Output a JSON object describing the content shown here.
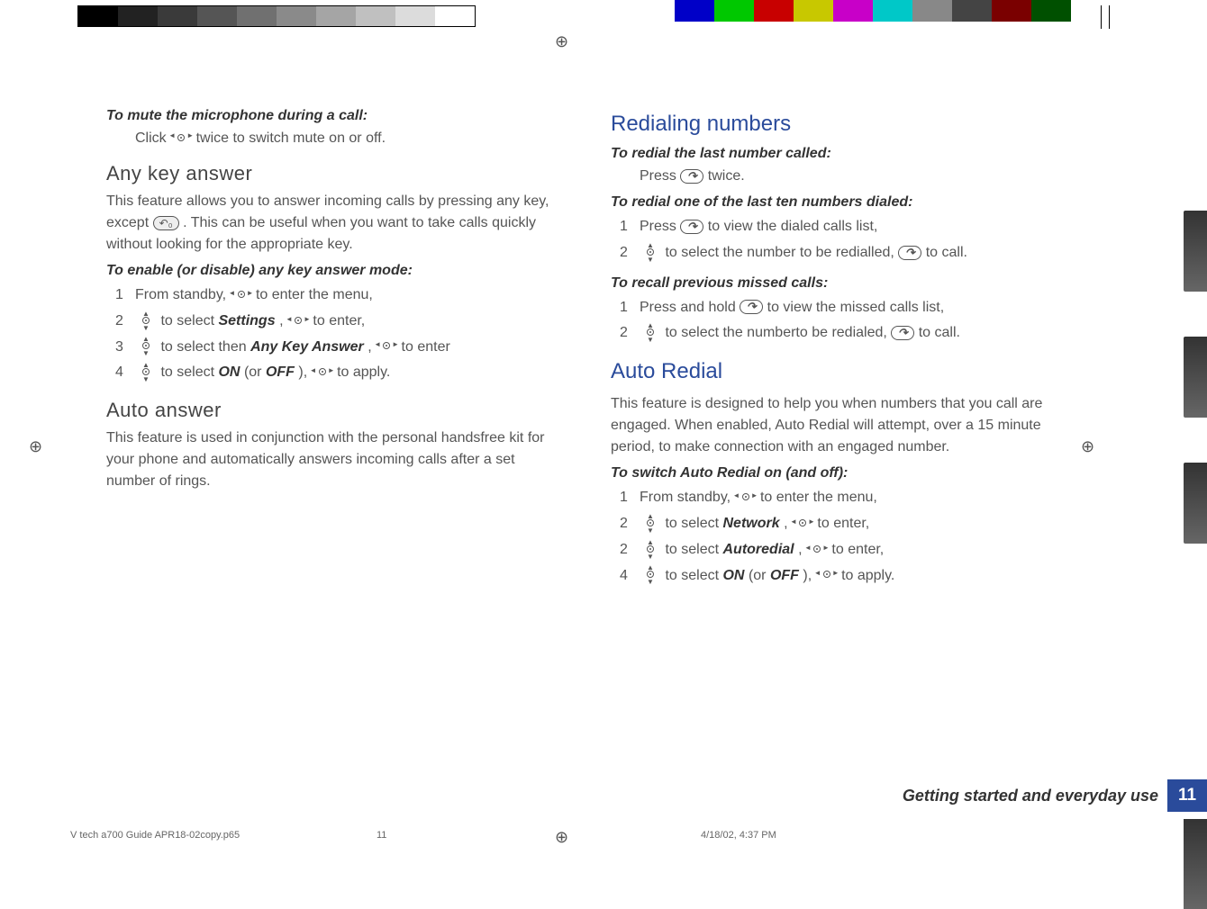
{
  "left": {
    "mute_head": "To mute the microphone during a call:",
    "mute_body_a": "Click ",
    "mute_body_b": " twice to switch mute on or off.",
    "anykey_head": "Any key answer",
    "anykey_body_a": "This feature allows you to answer incoming calls by pressing any key, except ",
    "anykey_body_b": ". This can be useful when you want to take calls quickly without looking for the appropriate key.",
    "enable_head": "To enable (or disable) any key answer mode:",
    "steps_a": {
      "s1a": "From standby, ",
      "s1b": " to enter the menu,",
      "s2a": " to select ",
      "s2b": "Settings",
      "s2c": ", ",
      "s2d": " to enter,",
      "s3a": " to select then ",
      "s3b": "Any Key Answer",
      "s3c": ", ",
      "s3d": " to enter",
      "s4a": " to select ",
      "s4b": "ON",
      "s4c": " (or ",
      "s4d": "OFF",
      "s4e": "), ",
      "s4f": " to apply."
    },
    "autoans_head": "Auto answer",
    "autoans_body": "This feature is used in conjunction with the personal handsfree kit for your phone and automatically answers incoming calls after a set number of rings."
  },
  "right": {
    "redial_head": "Redialing numbers",
    "redial_last_head": "To redial the last number called:",
    "redial_last_a": "Press ",
    "redial_last_b": " twice.",
    "redial_ten_head": "To redial one of the last ten numbers dialed:",
    "rt1a": "Press ",
    "rt1b": " to view the dialed calls list,",
    "rt2a": " to select the number to be redialled, ",
    "rt2b": " to call.",
    "missed_head": "To recall previous missed calls:",
    "m1a": "Press and hold ",
    "m1b": " to view the missed calls list,",
    "m2a": " to select the numberto be redialed, ",
    "m2b": " to call.",
    "autoredial_head": "Auto Redial",
    "autoredial_body": "This feature is designed to help you when numbers that you call are engaged. When enabled, Auto Redial will attempt, over a 15 minute period, to make connection with an engaged number.",
    "switch_head": "To switch Auto Redial on (and off):",
    "ar": {
      "s1a": "From standby, ",
      "s1b": " to enter the menu,",
      "s2a": " to select ",
      "s2b": "Network",
      "s2c": ", ",
      "s2d": " to enter,",
      "s3a": " to select ",
      "s3b": "Autoredial",
      "s3c": ", ",
      "s3d": " to enter,",
      "s4a": " to select ",
      "s4b": "ON",
      "s4c": " (or ",
      "s4d": "OFF",
      "s4e": "), ",
      "s4f": " to apply."
    }
  },
  "footer": {
    "section": "Getting started and everyday use",
    "page": "11",
    "file": "V tech a700 Guide APR18-02copy.p65",
    "pnum": "11",
    "date": "4/18/02, 4:37 PM"
  },
  "icons": {
    "end_label": "↶₀"
  },
  "gray_levels": [
    "#000",
    "#222",
    "#3a3a3a",
    "#555",
    "#707070",
    "#8a8a8a",
    "#a5a5a5",
    "#c0c0c0",
    "#dcdcdc",
    "#fff"
  ],
  "colors": [
    "#0000c8",
    "#00c800",
    "#c80000",
    "#c8c800",
    "#c800c8",
    "#00c8c8",
    "#888",
    "#444",
    "#7a0000",
    "#005000"
  ]
}
